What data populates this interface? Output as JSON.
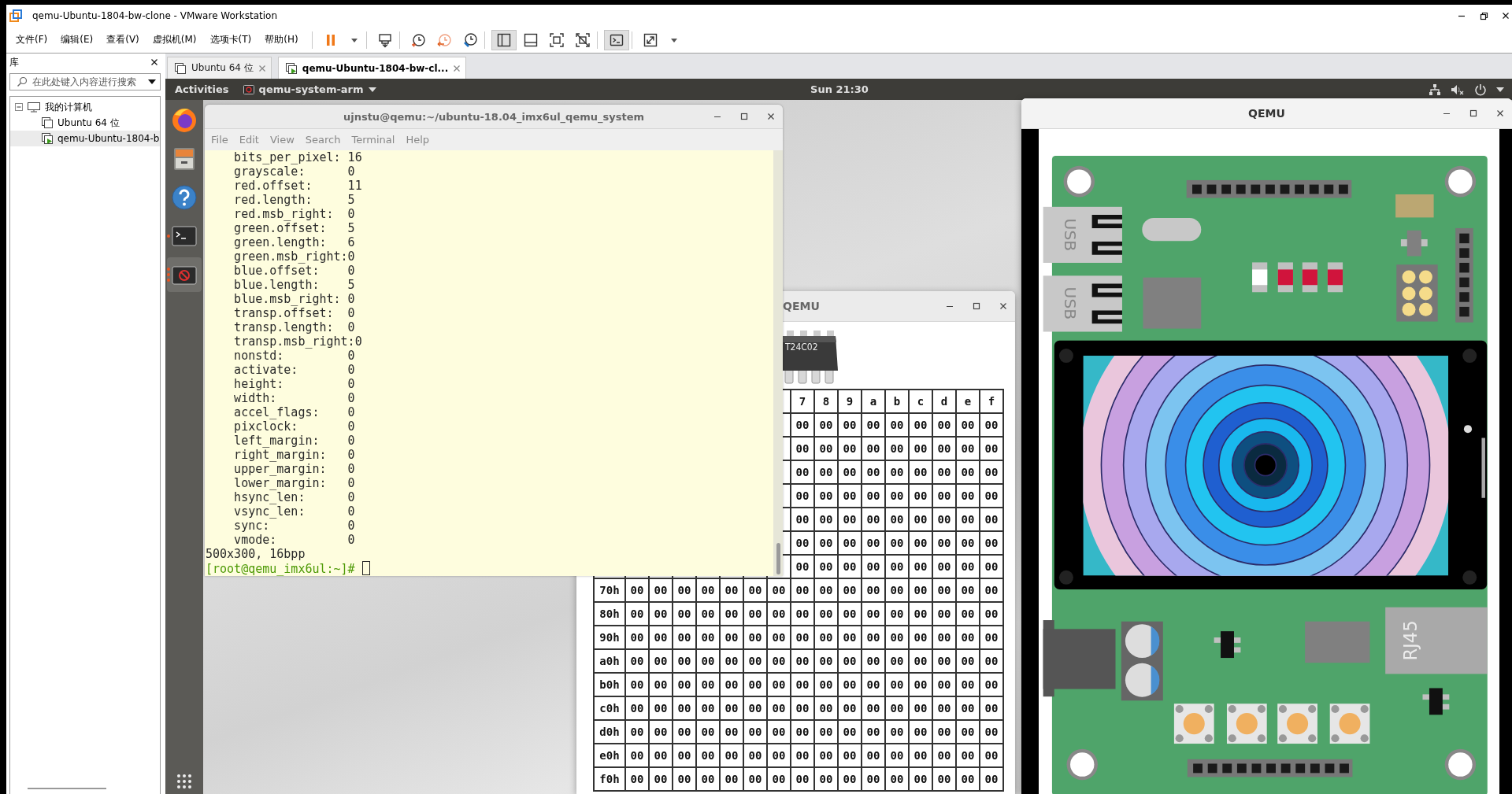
{
  "window": {
    "title": "qemu-Ubuntu-1804-bw-clone - VMware Workstation"
  },
  "menu": [
    "文件(F)",
    "编辑(E)",
    "查看(V)",
    "虚拟机(M)",
    "选项卡(T)",
    "帮助(H)"
  ],
  "toolbar": [
    [
      {
        "kind": "pause",
        "pressed": false
      },
      {
        "kind": "caret",
        "pressed": false
      }
    ],
    [
      {
        "kind": "send-keys",
        "pressed": false
      }
    ],
    [
      {
        "kind": "snapshot",
        "pressed": false
      },
      {
        "kind": "revert",
        "pressed": false
      },
      {
        "kind": "snapshot-manager",
        "pressed": false
      }
    ],
    [
      {
        "kind": "library-view",
        "pressed": true
      },
      {
        "kind": "thumbnail-bar",
        "pressed": false
      },
      {
        "kind": "fullscreen",
        "pressed": false
      },
      {
        "kind": "unity",
        "pressed": false
      }
    ],
    [
      {
        "kind": "console",
        "pressed": true
      }
    ],
    [
      {
        "kind": "stretch",
        "pressed": false
      },
      {
        "kind": "caret",
        "pressed": false
      }
    ]
  ],
  "library": {
    "title": "库",
    "search": {
      "placeholder": "在此处键入内容进行搜索"
    },
    "tree": [
      {
        "kind": "computer",
        "label": "我的计算机",
        "expanded": true,
        "selected": false,
        "children": [
          {
            "kind": "vm",
            "label": "Ubuntu 64 位",
            "running": false,
            "selected": false
          },
          {
            "kind": "vm",
            "label": "qemu-Ubuntu-1804-b",
            "running": true,
            "selected": true
          }
        ]
      }
    ]
  },
  "tabs": [
    {
      "label": "Ubuntu 64 位",
      "running": false,
      "selected": false
    },
    {
      "label": "qemu-Ubuntu-1804-bw-cl...",
      "running": true,
      "selected": true
    }
  ],
  "guest": {
    "top_bar": {
      "activities": "Activities",
      "app_menu": "qemu-system-arm",
      "clock": "Sun 21:30"
    },
    "dock": [
      {
        "kind": "browser",
        "running": false,
        "selected": false
      },
      {
        "kind": "files",
        "running": false,
        "selected": false
      },
      {
        "kind": "help",
        "running": false,
        "selected": false
      },
      {
        "kind": "terminal",
        "running": true,
        "multiple_windows": false,
        "selected": false
      },
      {
        "kind": "qemu",
        "running": true,
        "multiple_windows": true,
        "selected": true
      }
    ]
  },
  "terminal": {
    "title": "ujnstu@qemu:~/ubuntu-18.04_imx6ul_qemu_system",
    "menu": [
      "File",
      "Edit",
      "View",
      "Search",
      "Terminal",
      "Help"
    ],
    "lines": [
      {
        "text": "bits_per_pixel: 16",
        "indented": true
      },
      {
        "text": "grayscale:      0",
        "indented": true
      },
      {
        "text": "red.offset:     11",
        "indented": true
      },
      {
        "text": "red.length:     5",
        "indented": true
      },
      {
        "text": "red.msb_right:  0",
        "indented": true
      },
      {
        "text": "green.offset:   5",
        "indented": true
      },
      {
        "text": "green.length:   6",
        "indented": true
      },
      {
        "text": "green.msb_right:0",
        "indented": true
      },
      {
        "text": "blue.offset:    0",
        "indented": true
      },
      {
        "text": "blue.length:    5",
        "indented": true
      },
      {
        "text": "blue.msb_right: 0",
        "indented": true
      },
      {
        "text": "transp.offset:  0",
        "indented": true
      },
      {
        "text": "transp.length:  0",
        "indented": true
      },
      {
        "text": "transp.msb_right:0",
        "indented": true
      },
      {
        "text": "nonstd:         0",
        "indented": true
      },
      {
        "text": "activate:       0",
        "indented": true
      },
      {
        "text": "height:         0",
        "indented": true
      },
      {
        "text": "width:          0",
        "indented": true
      },
      {
        "text": "accel_flags:    0",
        "indented": true
      },
      {
        "text": "pixclock:       0",
        "indented": true
      },
      {
        "text": "left_margin:    0",
        "indented": true
      },
      {
        "text": "right_margin:   0",
        "indented": true
      },
      {
        "text": "upper_margin:   0",
        "indented": true
      },
      {
        "text": "lower_margin:   0",
        "indented": true
      },
      {
        "text": "hsync_len:      0",
        "indented": true
      },
      {
        "text": "vsync_len:      0",
        "indented": true
      },
      {
        "text": "sync:           0",
        "indented": true
      },
      {
        "text": "vmode:          0",
        "indented": true
      },
      {
        "text": "500x300, 16bpp",
        "indented": false
      }
    ],
    "prompt": "[root@qemu_imx6ul:~]#"
  },
  "eeprom_window": {
    "title": "QEMU",
    "chip_label": "T24C02",
    "columns": [
      "7",
      "8",
      "9",
      "a",
      "b",
      "c",
      "d",
      "e",
      "f"
    ],
    "rows": [
      {
        "cells": [
          "00",
          "00",
          "00",
          "00",
          "00",
          "00",
          "00",
          "00",
          "00"
        ]
      },
      {
        "cells": [
          "00",
          "00",
          "00",
          "00",
          "00",
          "00",
          "00",
          "00",
          "00"
        ]
      },
      {
        "cells": [
          "00",
          "00",
          "00",
          "00",
          "00",
          "00",
          "00",
          "00",
          "00"
        ]
      },
      {
        "cells": [
          "00",
          "00",
          "00",
          "00",
          "00",
          "00",
          "00",
          "00",
          "00"
        ]
      },
      {
        "cells": [
          "00",
          "00",
          "00",
          "00",
          "00",
          "00",
          "00",
          "00",
          "00"
        ]
      },
      {
        "cells": [
          "00",
          "00",
          "00",
          "00",
          "00",
          "00",
          "00",
          "00",
          "00"
        ]
      },
      {
        "cells": [
          "00",
          "00",
          "00",
          "00",
          "00",
          "00",
          "00",
          "00",
          "00"
        ]
      },
      {
        "address": "70h",
        "cells": [
          "00",
          "00",
          "00",
          "00",
          "00",
          "00",
          "00",
          "00",
          "00",
          "00",
          "00",
          "00",
          "00",
          "00",
          "00",
          "00"
        ]
      },
      {
        "address": "80h",
        "cells": [
          "00",
          "00",
          "00",
          "00",
          "00",
          "00",
          "00",
          "00",
          "00",
          "00",
          "00",
          "00",
          "00",
          "00",
          "00",
          "00"
        ]
      },
      {
        "address": "90h",
        "cells": [
          "00",
          "00",
          "00",
          "00",
          "00",
          "00",
          "00",
          "00",
          "00",
          "00",
          "00",
          "00",
          "00",
          "00",
          "00",
          "00"
        ]
      },
      {
        "address": "a0h",
        "cells": [
          "00",
          "00",
          "00",
          "00",
          "00",
          "00",
          "00",
          "00",
          "00",
          "00",
          "00",
          "00",
          "00",
          "00",
          "00",
          "00"
        ]
      },
      {
        "address": "b0h",
        "cells": [
          "00",
          "00",
          "00",
          "00",
          "00",
          "00",
          "00",
          "00",
          "00",
          "00",
          "00",
          "00",
          "00",
          "00",
          "00",
          "00"
        ]
      },
      {
        "address": "c0h",
        "cells": [
          "00",
          "00",
          "00",
          "00",
          "00",
          "00",
          "00",
          "00",
          "00",
          "00",
          "00",
          "00",
          "00",
          "00",
          "00",
          "00"
        ]
      },
      {
        "address": "d0h",
        "cells": [
          "00",
          "00",
          "00",
          "00",
          "00",
          "00",
          "00",
          "00",
          "00",
          "00",
          "00",
          "00",
          "00",
          "00",
          "00",
          "00"
        ]
      },
      {
        "address": "e0h",
        "cells": [
          "00",
          "00",
          "00",
          "00",
          "00",
          "00",
          "00",
          "00",
          "00",
          "00",
          "00",
          "00",
          "00",
          "00",
          "00",
          "00"
        ]
      },
      {
        "address": "f0h",
        "cells": [
          "00",
          "00",
          "00",
          "00",
          "00",
          "00",
          "00",
          "00",
          "00",
          "00",
          "00",
          "00",
          "00",
          "00",
          "00",
          "00"
        ]
      }
    ]
  },
  "board_window": {
    "title": "QEMU",
    "usb_labels": [
      "USB",
      "USB"
    ],
    "ethernet_label": "RJ45"
  }
}
